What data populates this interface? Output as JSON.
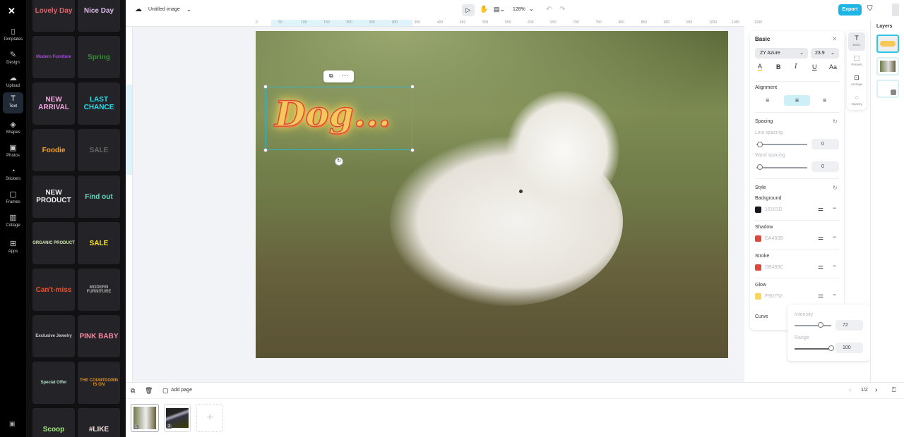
{
  "nav": {
    "items": [
      {
        "label": "Templates",
        "icon": "▯"
      },
      {
        "label": "Design",
        "icon": "✎"
      },
      {
        "label": "Upload",
        "icon": "☁"
      },
      {
        "label": "Text",
        "icon": "T"
      },
      {
        "label": "Shapes",
        "icon": "◈"
      },
      {
        "label": "Photos",
        "icon": "▣"
      },
      {
        "label": "Stickers",
        "icon": "◔"
      },
      {
        "label": "Frames",
        "icon": "▢"
      },
      {
        "label": "Collage",
        "icon": "▥"
      },
      {
        "label": "Apps",
        "icon": "⊞"
      }
    ]
  },
  "templates": [
    {
      "text": "Lovely Day",
      "color": "#e8606a"
    },
    {
      "text": "Nice Day",
      "color": "#d8b8e8"
    },
    {
      "text": "Modern Furniture",
      "color": "#a050d0"
    },
    {
      "text": "Spring",
      "color": "#3a8a3a"
    },
    {
      "text": "NEW ARRIVAL",
      "color": "#f2a6e0"
    },
    {
      "text": "LAST CHANCE",
      "color": "#20e0f0"
    },
    {
      "text": "Foodie",
      "color": "#f5a030"
    },
    {
      "text": "SALE",
      "color": "#666"
    },
    {
      "text": "NEW PRODUCT",
      "color": "#f0f0f0"
    },
    {
      "text": "Find out",
      "color": "#60d8c0"
    },
    {
      "text": "ORGANIC PRODUCT",
      "color": "#d0e8b0"
    },
    {
      "text": "SALE",
      "color": "#f8e020"
    },
    {
      "text": "Can't-miss",
      "color": "#f05028"
    },
    {
      "text": "MODERN FURNITURE",
      "color": "#aaa"
    },
    {
      "text": "Exclusive Jewelry",
      "color": "#ccc"
    },
    {
      "text": "PINK BABY",
      "color": "#f088a0"
    },
    {
      "text": "Special Offer",
      "color": "#b0e0c8"
    },
    {
      "text": "THE COUNTDOWN IS ON",
      "color": "#e09020"
    },
    {
      "text": "Scoop",
      "color": "#a8e880"
    },
    {
      "text": "#LIKE",
      "color": "#f4e0e0"
    }
  ],
  "header": {
    "title": "Untitled image",
    "zoom": "128%",
    "export": "Export"
  },
  "ruler": [
    "0",
    "50",
    "100",
    "150",
    "200",
    "250",
    "300",
    "350",
    "400",
    "450",
    "500",
    "550",
    "600",
    "650",
    "700",
    "750",
    "800",
    "850",
    "900",
    "950",
    "1000",
    "1050",
    "1100"
  ],
  "canvas": {
    "text": "Dog..."
  },
  "panel": {
    "title": "Basic",
    "font": "ZY Azure",
    "size": "23.9",
    "alignment": "Alignment",
    "spacing": "Spacing",
    "line_spacing": "Line spacing",
    "line_value": "0",
    "word_spacing": "Word spacing",
    "word_value": "0",
    "style": "Style",
    "styles": [
      {
        "label": "Background",
        "hex": "16161D",
        "color": "#16161D"
      },
      {
        "label": "Shadow",
        "hex": "DA493B",
        "color": "#DA493B"
      },
      {
        "label": "Stroke",
        "hex": "DB493C",
        "color": "#DB493C"
      },
      {
        "label": "Glow",
        "hex": "F9D752",
        "color": "#F9D752"
      }
    ],
    "curve": "Curve"
  },
  "glow": {
    "intensity_label": "Intensity",
    "intensity": "72",
    "range_label": "Range",
    "range": "100"
  },
  "tabs": [
    "Basic",
    "Presets",
    "Arrange",
    "Opacity"
  ],
  "layers": {
    "title": "Layers"
  },
  "bottom": {
    "add_page": "Add page",
    "pages": "1/2",
    "thumbs": [
      "1",
      "2"
    ]
  }
}
